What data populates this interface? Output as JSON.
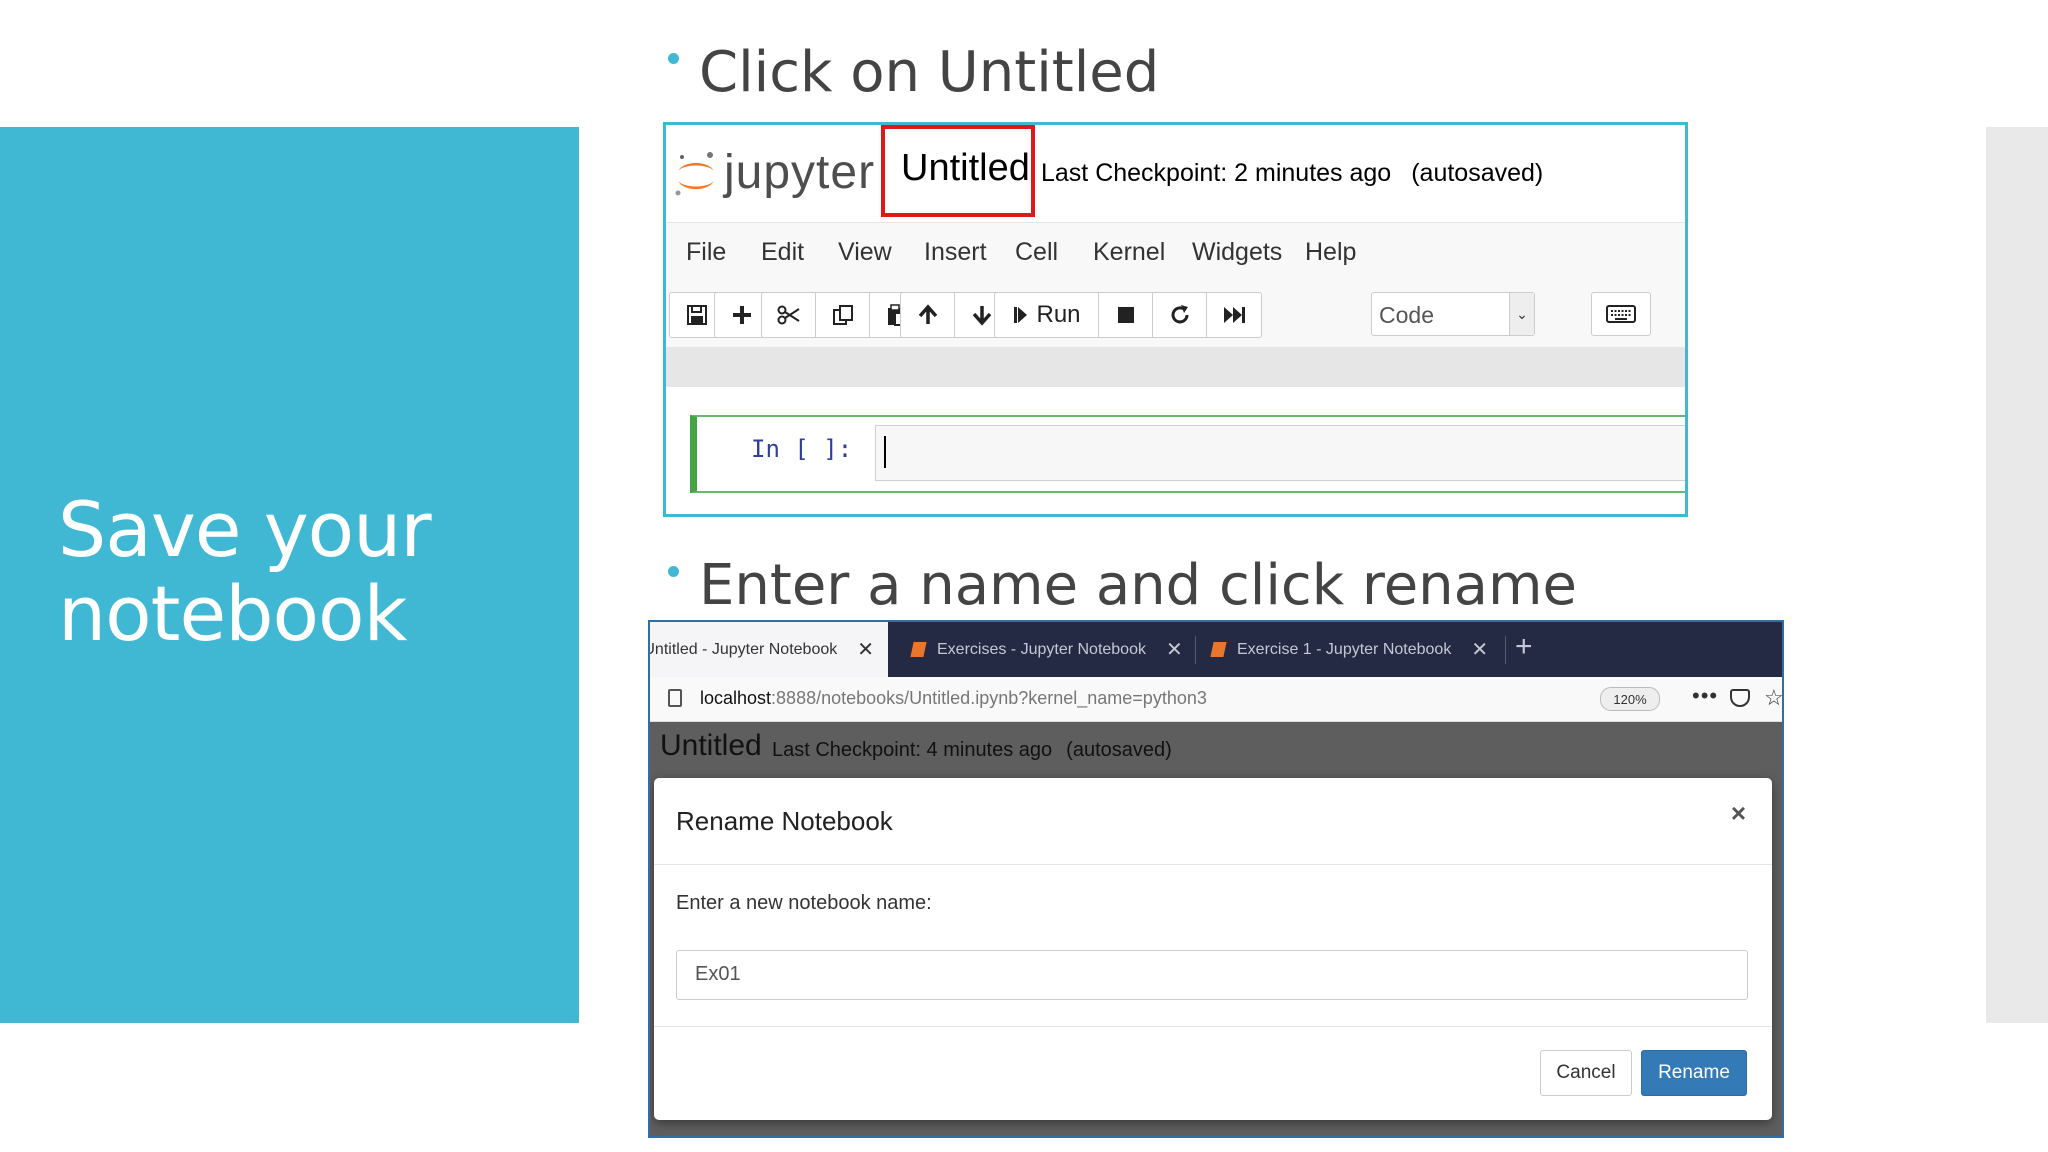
{
  "slide": {
    "title_line1": "Save your",
    "title_line2": "notebook",
    "bullet1": "Click on Untitled",
    "bullet2": "Enter  a name and click rename",
    "accent_color": "#41b8d3"
  },
  "jupyter": {
    "logo_text": "jupyter",
    "notebook_name": "Untitled",
    "checkpoint": "Last Checkpoint: 2 minutes ago",
    "autosaved": "(autosaved)",
    "menu": [
      "File",
      "Edit",
      "View",
      "Insert",
      "Cell",
      "Kernel",
      "Widgets",
      "Help"
    ],
    "toolbar": {
      "run_label": "Run",
      "cell_type": "Code",
      "icons": [
        "save-icon",
        "add-cell-icon",
        "cut-icon",
        "copy-icon",
        "paste-icon",
        "move-up-icon",
        "move-down-icon",
        "run-icon",
        "stop-icon",
        "restart-icon",
        "fast-forward-icon",
        "keyboard-icon"
      ]
    },
    "cell_prompt": "In [ ]:"
  },
  "browser": {
    "tabs": [
      {
        "label": "Untitled - Jupyter Notebook",
        "active": true
      },
      {
        "label": "Exercises - Jupyter Notebook",
        "active": false
      },
      {
        "label": "Exercise 1 - Jupyter Notebook",
        "active": false
      }
    ],
    "url_host": "localhost",
    "url_path": ":8888/notebooks/Untitled.ipynb?kernel_name=python3",
    "zoom": "120%",
    "page_title": "Untitled",
    "page_checkpoint": "Last Checkpoint: 4 minutes ago",
    "page_autosaved": "(autosaved)"
  },
  "dialog": {
    "title": "Rename Notebook",
    "close": "×",
    "label": "Enter a new notebook name:",
    "input_value": "Ex01",
    "cancel_label": "Cancel",
    "rename_label": "Rename"
  }
}
